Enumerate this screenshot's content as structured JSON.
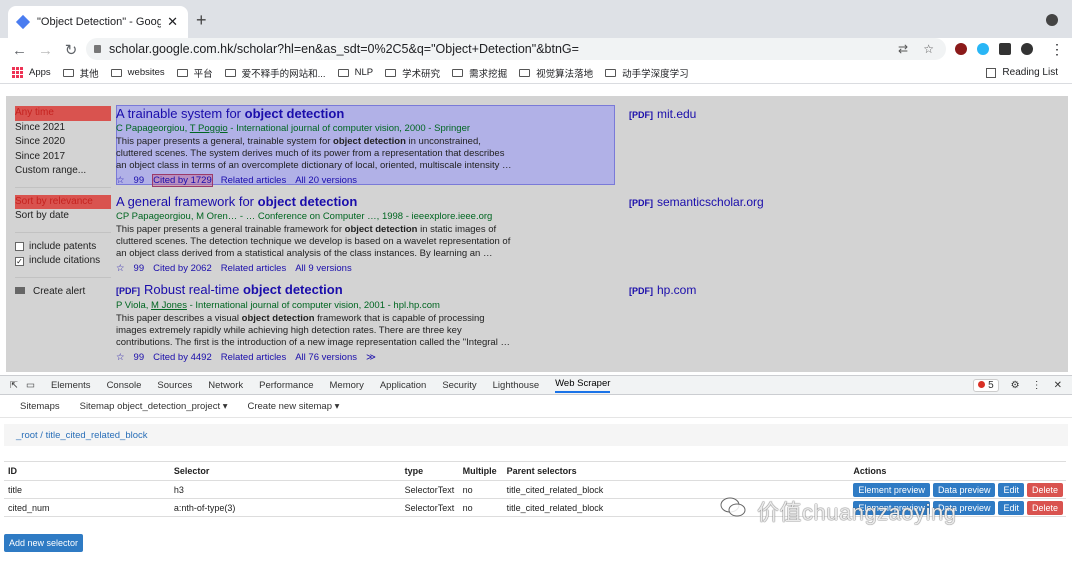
{
  "browser": {
    "tab_title": "\"Object Detection\" - Google S",
    "url": "scholar.google.com.hk/scholar?hl=en&as_sdt=0%2C5&q=\"Object+Detection\"&btnG=",
    "bookmarks": [
      "Apps",
      "其他",
      "websites",
      "平台",
      "爱不释手的网站和...",
      "NLP",
      "学术研究",
      "需求挖掘",
      "视觉算法落地",
      "动手学深度学习"
    ],
    "reading_list": "Reading List"
  },
  "filters": {
    "time": [
      "Any time",
      "Since 2021",
      "Since 2020",
      "Since 2017",
      "Custom range..."
    ],
    "sort": [
      "Sort by relevance",
      "Sort by date"
    ],
    "include_patents": "include patents",
    "include_citations": "include citations",
    "create_alert": "Create alert"
  },
  "results": [
    {
      "title_pre": "A trainable system for ",
      "title_bold": "object detection",
      "authors_pre": "C Papageorgiou, ",
      "authors_link": "T Poggio",
      "authors_post": " - International journal of computer vision, 2000 - Springer",
      "snippet_1": "This paper presents a general, trainable system for ",
      "snippet_bold": "object detection",
      "snippet_2": " in unconstrained, cluttered scenes. The system derives much of its power from a representation that describes an object class in terms of an overcomplete dictionary of local, oriented, multiscale intensity …",
      "cited_by": "Cited by 1729",
      "related": "Related articles",
      "versions": "All 20 versions",
      "pdf_tag": "[PDF]",
      "pdf_source": "mit.edu"
    },
    {
      "title_pre": "A general framework for ",
      "title_bold": "object detection",
      "authors_pre": "CP Papageorgiou, M Oren… - … Conference on Computer …, 1998 - ieeexplore.ieee.org",
      "authors_link": "",
      "authors_post": "",
      "snippet_1": "This paper presents a general trainable framework for ",
      "snippet_bold": "object detection",
      "snippet_2": " in static images of cluttered scenes. The detection technique we develop is based on a wavelet representation of an object class derived from a statistical analysis of the class instances. By learning an …",
      "cited_by": "Cited by 2062",
      "related": "Related articles",
      "versions": "All 9 versions",
      "pdf_tag": "[PDF]",
      "pdf_source": "semanticscholar.org"
    },
    {
      "title_pre": "Robust real-time ",
      "title_bold": "object detection",
      "title_tag": "[PDF]",
      "authors_pre": "P Viola, ",
      "authors_link": "M Jones",
      "authors_post": " - International journal of computer vision, 2001 - hpl.hp.com",
      "snippet_1": "This paper describes a visual ",
      "snippet_bold": "object detection",
      "snippet_2": " framework that is capable of processing images extremely rapidly while achieving high detection rates. There are three key contributions. The first is the introduction of a new image representation called the \"Integral …",
      "cited_by": "Cited by 4492",
      "related": "Related articles",
      "versions": "All 76 versions",
      "pdf_tag": "[PDF]",
      "pdf_source": "hp.com"
    }
  ],
  "devtools": {
    "tabs": [
      "Elements",
      "Console",
      "Sources",
      "Network",
      "Performance",
      "Memory",
      "Application",
      "Security",
      "Lighthouse",
      "Web Scraper"
    ],
    "error_count": "5"
  },
  "scraper": {
    "nav": [
      "Sitemaps",
      "Sitemap object_detection_project ▾",
      "Create new sitemap ▾"
    ],
    "breadcrumb": "_root  /  title_cited_related_block",
    "columns": [
      "ID",
      "Selector",
      "type",
      "Multiple",
      "Parent selectors",
      "Actions"
    ],
    "rows": [
      {
        "id": "title",
        "selector": "h3",
        "type": "SelectorText",
        "multiple": "no",
        "parent": "title_cited_related_block"
      },
      {
        "id": "cited_num",
        "selector": "a:nth-of-type(3)",
        "type": "SelectorText",
        "multiple": "no",
        "parent": "title_cited_related_block"
      }
    ],
    "actions": [
      "Element preview",
      "Data preview",
      "Edit",
      "Delete"
    ],
    "add_button": "Add new selector"
  },
  "watermark": "价值chuangzaoying"
}
